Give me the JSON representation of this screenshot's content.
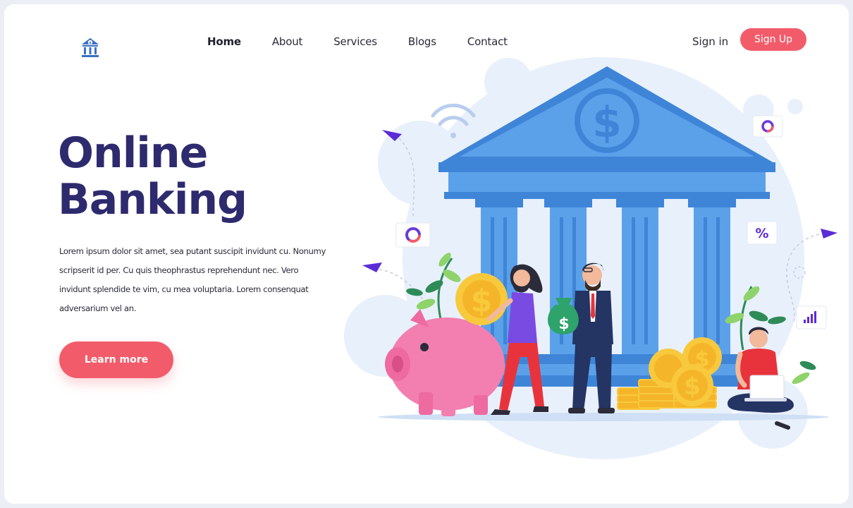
{
  "nav": {
    "logo_icon": "bank-icon",
    "items": [
      {
        "label": "Home",
        "active": true
      },
      {
        "label": "About",
        "active": false
      },
      {
        "label": "Services",
        "active": false
      },
      {
        "label": "Blogs",
        "active": false
      },
      {
        "label": "Contact",
        "active": false
      }
    ],
    "signin_label": "Sign in",
    "signup_label": "Sign Up"
  },
  "hero": {
    "title_line1": "Online",
    "title_line2": "Banking",
    "body": "Lorem ipsum dolor sit amet, sea putant suscipit invidunt cu. Nonumy scripserit id per. Cu quis theophrastus reprehendunt nec. Vero invidunt splendide te vim, cu mea voluptaria. Lorem consenquat adversarium vel an.",
    "cta_label": "Learn more"
  },
  "illustration": {
    "dollar_symbol": "$",
    "percent_symbol": "%"
  },
  "colors": {
    "accent": "#f25c6a",
    "title": "#2e2a6e",
    "bank_blue": "#4a90d9",
    "coin": "#f8c93c",
    "piggy": "#f27fb0"
  }
}
